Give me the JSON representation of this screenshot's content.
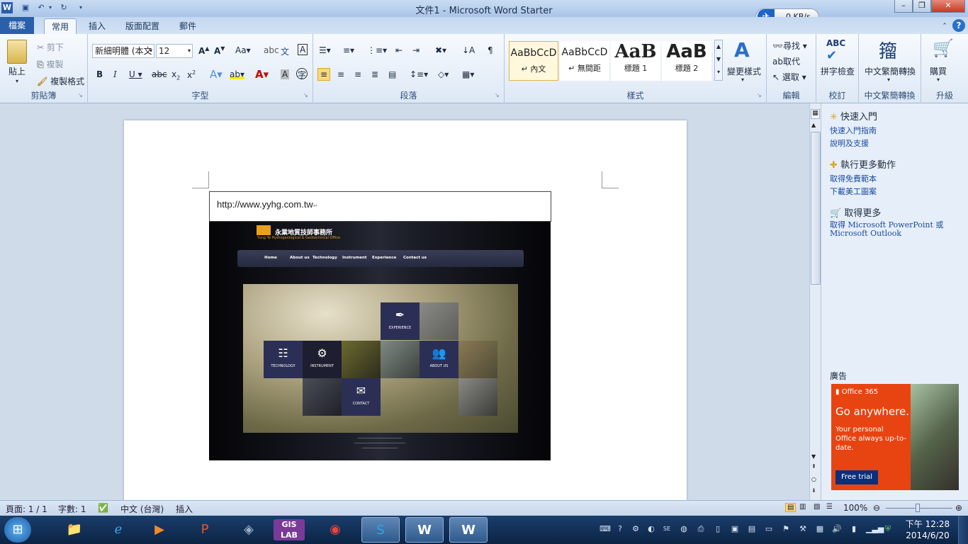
{
  "window": {
    "title": "文件1 - Microsoft Word Starter"
  },
  "network_widget": {
    "speed": "0 KB/s"
  },
  "tabs": [
    {
      "label": "檔案"
    },
    {
      "label": "常用"
    },
    {
      "label": "插入"
    },
    {
      "label": "版面配置"
    },
    {
      "label": "郵件"
    }
  ],
  "ribbon": {
    "clipboard": {
      "paste": "貼上",
      "cut": "剪下",
      "copy": "複製",
      "format_painter": "複製格式",
      "group_label": "剪貼簿"
    },
    "font": {
      "font_name": "新細明體 (本文",
      "font_size": "12",
      "group_label": "字型"
    },
    "paragraph": {
      "group_label": "段落"
    },
    "styles": {
      "items": [
        {
          "sample": "AaBbCcD",
          "name": "↵ 內文"
        },
        {
          "sample": "AaBbCcD",
          "name": "↵ 無間距"
        },
        {
          "sample": "AaB",
          "name": "標題 1"
        },
        {
          "sample": "AaB",
          "name": "標題 2"
        }
      ],
      "change_styles": "變更樣式",
      "group_label": "樣式"
    },
    "editing": {
      "find": "尋找",
      "replace": "取代",
      "select": "選取",
      "group_label": "編輯"
    },
    "proofing": {
      "spell": "拼字檢查",
      "group_label": "校訂"
    },
    "chinese_conv": {
      "label": "中文繁簡轉換",
      "group_label": "中文繁簡轉換"
    },
    "upgrade": {
      "buy": "購買",
      "group_label": "升級"
    }
  },
  "document": {
    "url_text": "http://www.yyhg.com.tw",
    "site": {
      "company": "永業地質技師事務所",
      "company_en": "Yung Ye Hydrogeological & Geotechnical Office",
      "nav": [
        "Home",
        "About us",
        "Technology",
        "Instrument",
        "Experience",
        "Contact us"
      ],
      "tiles": [
        "EXPERIENCE",
        "TECHNOLOGY",
        "INSTRUMENT",
        "ABOUT US",
        "CONTACT"
      ]
    }
  },
  "task_pane": {
    "quick_start": "快速入門",
    "quick_start_guide": "快速入門指南",
    "help": "說明及支援",
    "more_actions": "執行更多動作",
    "free_templates": "取得免費範本",
    "clip_art": "下載美工圖案",
    "get_more": "取得更多",
    "get_office": "取得 Microsoft PowerPoint 或 Microsoft Outlook",
    "ad_label": "廣告",
    "ad": {
      "brand": "Office 365",
      "headline": "Go anywhere.",
      "body": "Your personal Office always up-to-date.",
      "cta": "Free trial"
    }
  },
  "status": {
    "page": "頁面: 1 / 1",
    "words": "字數: 1",
    "language": "中文 (台灣)",
    "mode": "插入",
    "zoom": "100%"
  },
  "clock": {
    "time": "下午 12:28",
    "date": "2014/6/20"
  }
}
